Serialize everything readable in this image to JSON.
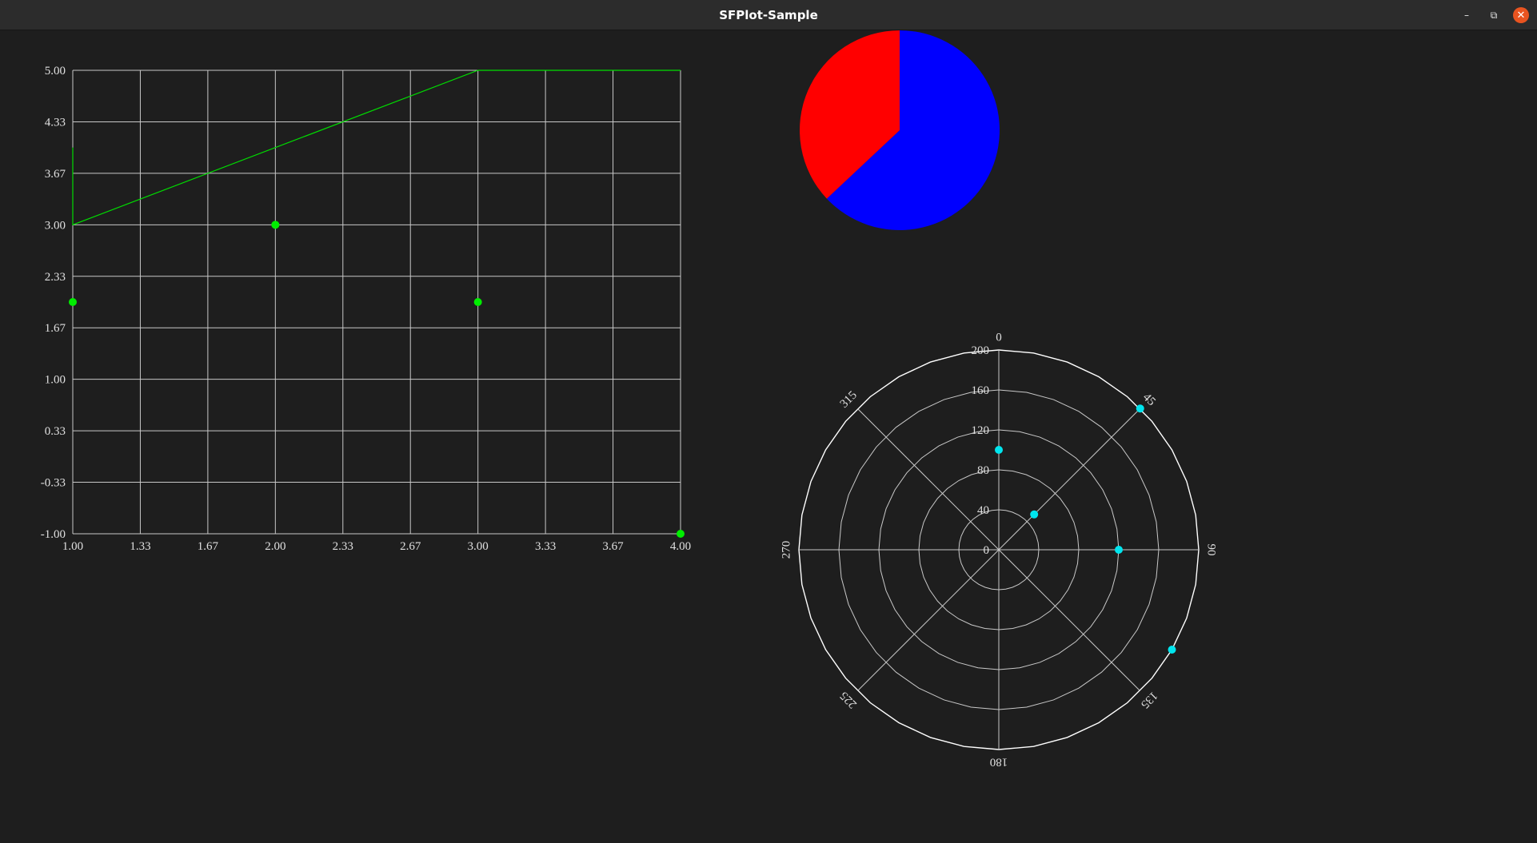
{
  "window": {
    "title": "SFPlot-Sample",
    "minimize_glyph": "–",
    "maximize_glyph": "⧉",
    "close_glyph": "✕"
  },
  "colors": {
    "background": "#1e1e1e",
    "grid": "#c8c8c8",
    "line_series": "#00dd00",
    "point_series": "#00ee00",
    "pie_red": "#ff0000",
    "pie_blue": "#0000ff",
    "polar_points": "#00e5ee"
  },
  "chart_data": [
    {
      "type": "line",
      "xlim": [
        1,
        4
      ],
      "ylim": [
        -1,
        5
      ],
      "x_ticks": [
        "1.00",
        "1.33",
        "1.67",
        "2.00",
        "2.33",
        "2.67",
        "3.00",
        "3.33",
        "3.67",
        "4.00"
      ],
      "y_ticks": [
        "5.00",
        "4.33",
        "3.67",
        "3.00",
        "2.33",
        "1.67",
        "1.00",
        "0.33",
        "-0.33",
        "-1.00"
      ],
      "series": [
        {
          "kind": "line",
          "points": [
            [
              1,
              4
            ],
            [
              1,
              3
            ],
            [
              3,
              5
            ],
            [
              4,
              5
            ]
          ]
        },
        {
          "kind": "scatter",
          "points": [
            [
              1,
              2
            ],
            [
              2,
              3
            ],
            [
              3,
              2
            ],
            [
              4,
              -1
            ]
          ]
        }
      ],
      "grid": true
    },
    {
      "type": "pie",
      "slices": [
        {
          "value": 63,
          "color": "#0000ff"
        },
        {
          "value": 37,
          "color": "#ff0000"
        }
      ]
    },
    {
      "type": "scatter",
      "projection": "polar",
      "r_max": 200,
      "r_ticks": [
        "0",
        "40",
        "80",
        "120",
        "160",
        "200"
      ],
      "angle_ticks": [
        "0",
        "45",
        "90",
        "135",
        "180",
        "225",
        "270",
        "315"
      ],
      "points": [
        {
          "angle": 0,
          "r": 100
        },
        {
          "angle": 45,
          "r": 50
        },
        {
          "angle": 45,
          "r": 200
        },
        {
          "angle": 90,
          "r": 120
        },
        {
          "angle": 120,
          "r": 200
        }
      ],
      "grid": true
    }
  ]
}
